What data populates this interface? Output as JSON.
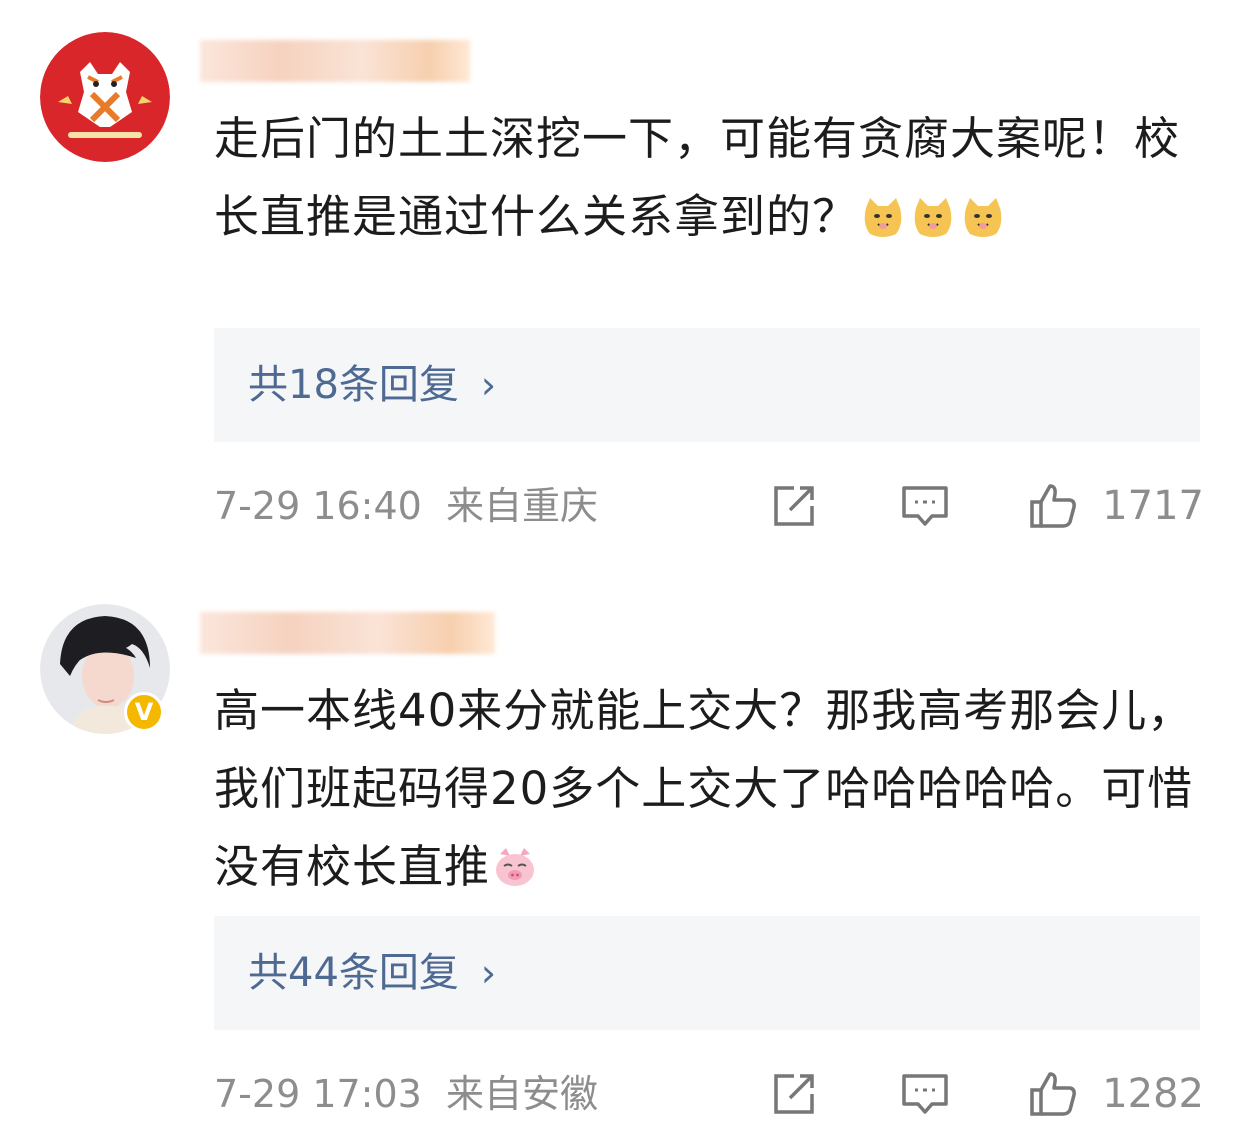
{
  "comments": [
    {
      "avatar_icon": "tiger-avatar-icon",
      "text_main": "走后门的土土深挖一下，可能有贪腐大案呢！校长直推是通过什么关系拿到的？",
      "emojis": [
        "doge-emoji",
        "doge-emoji",
        "doge-emoji"
      ],
      "replies_label": "共18条回复",
      "chevron": "›",
      "date": "7-29 16:40",
      "location": "来自重庆",
      "likes": "1717"
    },
    {
      "avatar_icon": "user-photo-avatar-icon",
      "verified_badge": "V",
      "text_main": "高一本线40来分就能上交大？那我高考那会儿，我们班起码得20多个上交大了哈哈哈哈哈。可惜没有校长直推",
      "emojis": [
        "pig-emoji"
      ],
      "replies_label": "共44条回复",
      "chevron": "›",
      "date": "7-29 17:03",
      "location": "来自安徽",
      "likes": "1282"
    }
  ],
  "colors": {
    "link": "#4f6a92",
    "meta": "#8d8d8d",
    "text": "#1c1c1c",
    "reply_bg": "#f5f6f8",
    "avatar_red": "#d9262a",
    "badge_gold": "#f5b800"
  }
}
